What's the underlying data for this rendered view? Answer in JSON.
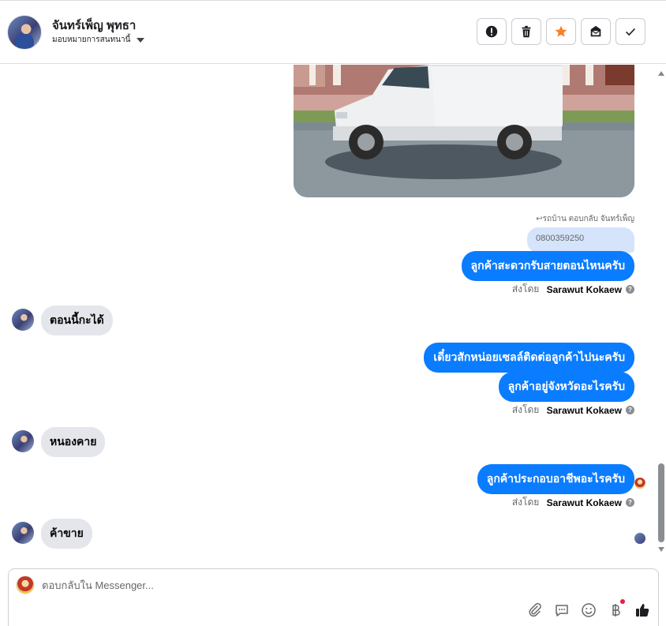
{
  "header": {
    "contact_name": "จันทร์เพ็ญ พุทธา",
    "assign_label": "มอบหมายการสนทนานี้",
    "actions": [
      "report-icon",
      "trash-icon",
      "star-icon",
      "mark-unread-icon",
      "check-icon"
    ]
  },
  "messages": {
    "reply_note": "รถบ้าน ตอบกลับ จันทร์เพ็ญ",
    "quoted_text": "0800359250",
    "out_1": "ลูกค้าสะดวกรับสายตอนไหนครับ",
    "sent_by_prefix": "ส่งโดย",
    "sent_by_name": "Sarawut Kokaew",
    "in_1": "ตอนนี้กะได้",
    "out_2": "เดี๋ยวสักหน่อยเซลล์ติดต่อลูกค้าไปนะครับ",
    "out_3": "ลูกค้าอยู่จังหวัดอะไรครับ",
    "in_2": "หนองคาย",
    "out_4": "ลูกค้าประกอบอาชีพอะไรครับ",
    "in_3": "ค้าขาย"
  },
  "composer": {
    "placeholder": "ตอบกลับใน Messenger..."
  },
  "colors": {
    "outgoing_bubble": "#0a7cff",
    "incoming_bubble": "#e4e6eb",
    "quoted_bubble": "#d5e4fb",
    "star": "#f5822a"
  }
}
